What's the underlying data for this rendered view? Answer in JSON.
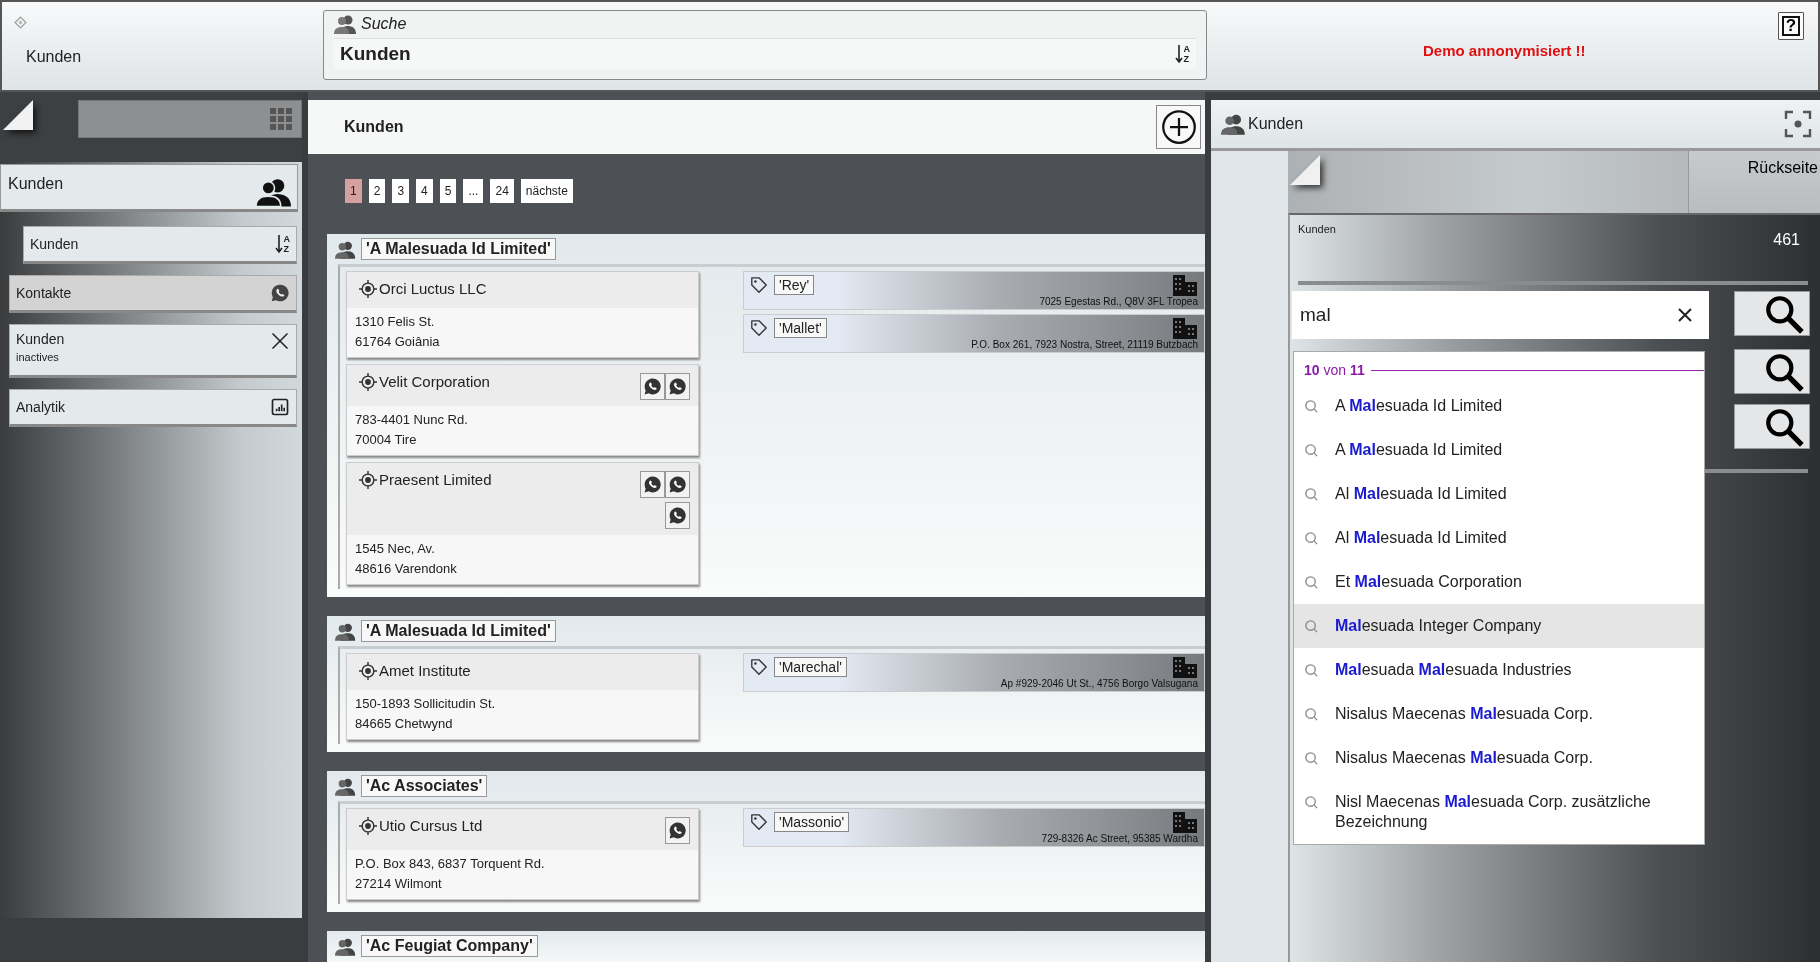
{
  "header": {
    "title": "Kunden",
    "search_label": "Suche",
    "search_value": "Kunden",
    "sort_letters": [
      "A",
      "Z"
    ],
    "notice": "Demo annonymisiert !!",
    "help": "?"
  },
  "sidebar": {
    "main": "Kunden",
    "items": [
      {
        "kind": "sort",
        "label": "Kunden",
        "letters": [
          "A",
          "Z"
        ],
        "selected": false
      },
      {
        "kind": "chat",
        "label": "Kontakte",
        "selected": true
      },
      {
        "kind": "close",
        "label": "Kunden",
        "sub": "inactives",
        "selected": false
      },
      {
        "kind": "chart",
        "label": "Analytik",
        "selected": false
      }
    ]
  },
  "list": {
    "title": "Kunden",
    "pages": [
      {
        "label": "1",
        "selected": true
      },
      {
        "label": "2",
        "selected": false
      },
      {
        "label": "3",
        "selected": false
      },
      {
        "label": "4",
        "selected": false
      },
      {
        "label": "5",
        "selected": false
      },
      {
        "label": "...",
        "selected": false
      },
      {
        "label": "24",
        "selected": false
      },
      {
        "label": "nächste",
        "selected": false
      }
    ],
    "groups": [
      {
        "name": "'A Malesuada Id Limited'",
        "contacts": [
          {
            "name": "Orci Luctus LLC",
            "lines": [
              "1310 Felis St.",
              "61764 Goiânia"
            ]
          },
          {
            "name": "Velit Corporation",
            "lines": [
              "783-4401 Nunc Rd.",
              "70004 Tire"
            ],
            "buttons": [
              {
                "kind": "whatsapp"
              },
              {
                "kind": "whatsapp"
              }
            ]
          },
          {
            "name": "Praesent Limited",
            "lines": [
              "1545 Nec, Av.",
              "48616 Varendonk"
            ],
            "buttons": [
              {
                "kind": "whatsapp"
              },
              {
                "kind": "whatsapp"
              },
              {
                "kind": "whatsapp"
              }
            ]
          }
        ],
        "tags": [
          {
            "label": "'Rey'",
            "address": "7025 Egestas Rd., Q8V 3FL Tropea"
          },
          {
            "label": "'Mallet'",
            "address": "P.O. Box 261, 7923 Nostra, Street, 21119 Butzbach"
          }
        ]
      },
      {
        "name": "'A Malesuada Id Limited'",
        "contacts": [
          {
            "name": "Amet Institute",
            "lines": [
              "150-1893 Sollicitudin St.",
              "84665 Chetwynd"
            ]
          }
        ],
        "tags": [
          {
            "label": "'Marechal'",
            "address": "Ap #929-2046 Ut St., 4756 Borgo Valsugana"
          }
        ]
      },
      {
        "name": "'Ac Associates'",
        "contacts": [
          {
            "name": "Utio Cursus Ltd",
            "lines": [
              "P.O. Box 843, 6837 Torquent Rd.",
              "27214 Wilmont"
            ],
            "buttons": [
              {
                "kind": "whatsapp"
              }
            ]
          }
        ],
        "tags": [
          {
            "label": "'Massonio'",
            "address": "729-8326 Ac Street, 95385 Wardha"
          }
        ]
      },
      {
        "name": "'Ac Feugiat Company'"
      }
    ]
  },
  "detail": {
    "title": "Kunden",
    "back": "Rückseite",
    "list_label": "Kunden",
    "count": "461",
    "search": {
      "value": "mal"
    },
    "suggest": {
      "summary": "**10** von **11**",
      "items": [
        {
          "text": "A **Mal**esuada Id Limited",
          "selected": false
        },
        {
          "text": "A **Mal**esuada Id Limited",
          "selected": false
        },
        {
          "text": "Al **Mal**esuada Id Limited",
          "selected": false
        },
        {
          "text": "Al **Mal**esuada Id Limited",
          "selected": false
        },
        {
          "text": "Et **Mal**esuada Corporation",
          "selected": false
        },
        {
          "text": "**Mal**esuada Integer Company",
          "selected": true
        },
        {
          "text": "**Mal**esuada **Mal**esuada Industries",
          "selected": false
        },
        {
          "text": "Nisalus Maecenas **Mal**esuada Corp.",
          "selected": false
        },
        {
          "text": "Nisalus Maecenas **Mal**esuada Corp.",
          "selected": false
        },
        {
          "text": "Nisl Maecenas **Mal**esuada Corp. zusätzliche Bezeichnung",
          "selected": false
        }
      ]
    }
  }
}
